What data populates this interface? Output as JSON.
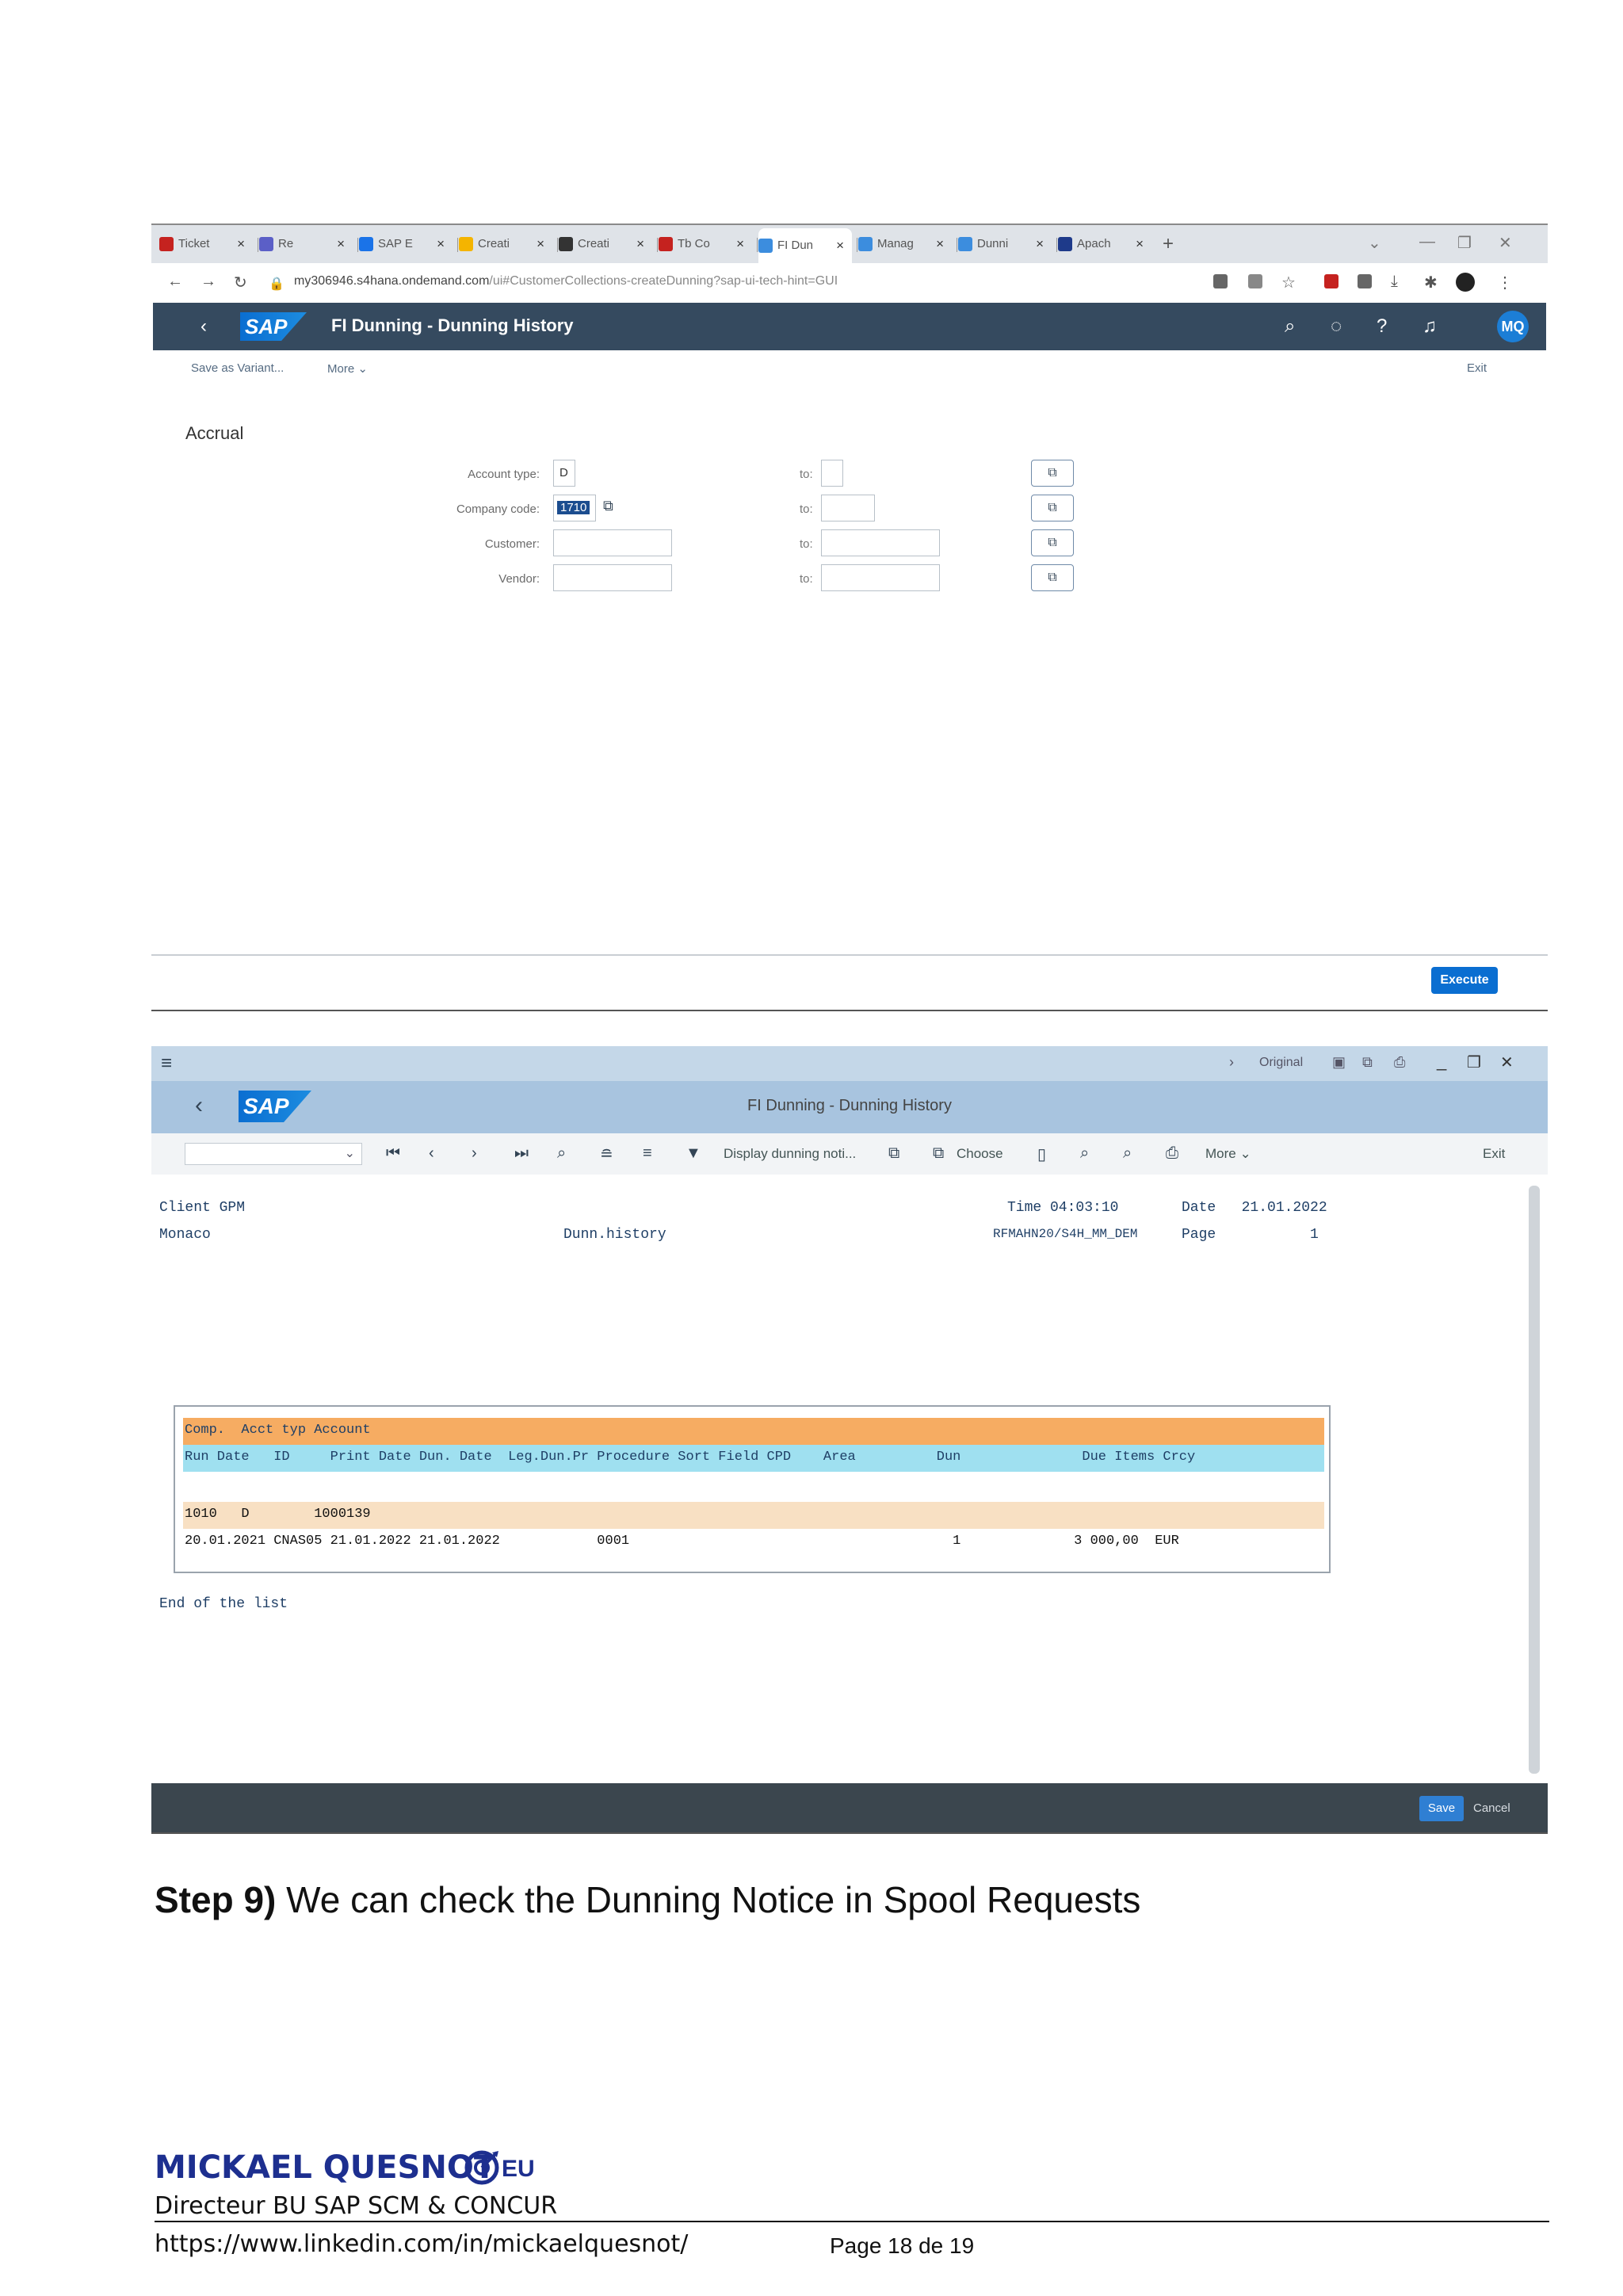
{
  "shot1": {
    "tabs": [
      {
        "label": "Ticket",
        "color": "#c5221f"
      },
      {
        "label": "Re",
        "color": "#5b5fc7"
      },
      {
        "label": "SAP E",
        "color": "#1a73e8"
      },
      {
        "label": "Creati",
        "color": "#f4b400"
      },
      {
        "label": "Creati",
        "color": "#333333"
      },
      {
        "label": "Tb Co",
        "color": "#c5221f"
      },
      {
        "label": "FI Dun",
        "color": "#3c8dde"
      },
      {
        "label": "Manag",
        "color": "#3c8dde"
      },
      {
        "label": "Dunni",
        "color": "#3c8dde"
      },
      {
        "label": "Apach",
        "color": "#1e3a8a"
      }
    ],
    "tab_close": "×",
    "new_tab": "+",
    "url_host": "my306946.s4hana.ondemand.com",
    "url_path": "/ui#CustomerCollections-createDunning?sap-ui-tech-hint=GUI",
    "app_title": "FI Dunning - Dunning History",
    "logo": "SAP",
    "avatar": "MQ",
    "toolbar": {
      "save_variant": "Save as Variant...",
      "more": "More",
      "exit": "Exit"
    },
    "section": "Accrual",
    "fields": [
      {
        "label": "Account type:",
        "value": "D",
        "to": "to:"
      },
      {
        "label": "Company code:",
        "value": "1710",
        "to": "to:"
      },
      {
        "label": "Customer:",
        "value": "",
        "to": "to:"
      },
      {
        "label": "Vendor:",
        "value": "",
        "to": "to:"
      }
    ],
    "execute": "Execute"
  },
  "shot2": {
    "logo": "SAP",
    "title": "FI Dunning - Dunning History",
    "top_right": "Original",
    "toolbar": {
      "display": "Display dunning noti...",
      "choose": "Choose",
      "more": "More",
      "exit": "Exit"
    },
    "header": {
      "client": "Client GPM",
      "city": "Monaco",
      "time": "Time 04:03:10",
      "date": "Date   21.01.2022",
      "report": "Dunn.history",
      "program": "RFMAHN20/S4H_MM_DEM",
      "page": "Page           1"
    },
    "list": {
      "hdr1": "Comp.  Acct typ Account",
      "hdr2": "Run Date   ID     Print Date Dun. Date  Leg.Dun.Pr Procedure Sort Field CPD    Area          Dun               Due Items Crcy",
      "row1": "1010   D        1000139",
      "row2": "20.01.2021 CNAS05 21.01.2022 21.01.2022            0001                                        1              3 000,00  EUR"
    },
    "end": "End of the list",
    "save": "Save",
    "cancel": "Cancel"
  },
  "doc": {
    "step_bold": "Step 9)",
    "step_text": " We can check the Dunning Notice in Spool Requests",
    "author": "MICKAEL QUESNOT",
    "author_suffix": "EU",
    "role": "Directeur BU SAP SCM & CONCUR",
    "link": "https://www.linkedin.com/in/mickaelquesnot/",
    "page": "Page 18 de 19",
    "brand_color": "#1d2f8f"
  }
}
